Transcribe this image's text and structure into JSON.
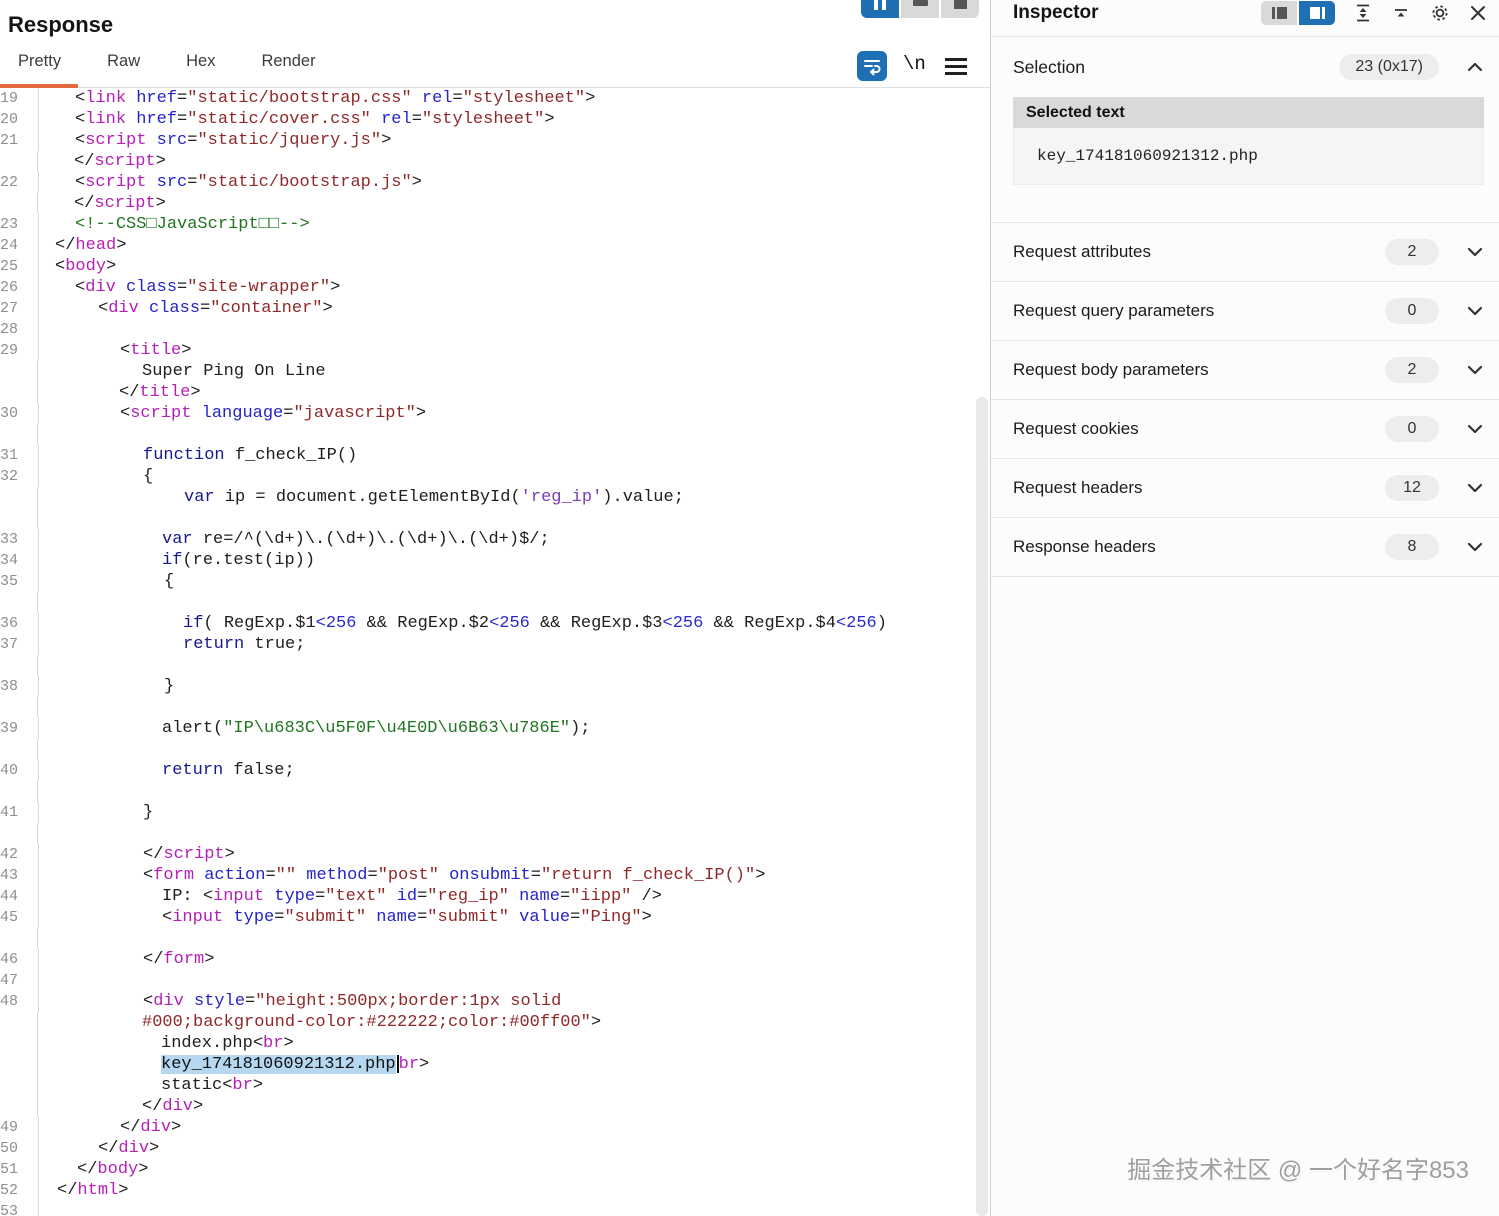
{
  "left_panel": {
    "title": "Response",
    "tabs": [
      {
        "label": "Pretty",
        "active": true
      },
      {
        "label": "Raw",
        "active": false
      },
      {
        "label": "Hex",
        "active": false
      },
      {
        "label": "Render",
        "active": false
      }
    ],
    "toolbar": {
      "newline_label": "\\n"
    },
    "code": {
      "lines": [
        {
          "n": "19",
          "i": 20,
          "s": [
            [
              "p",
              "<"
            ],
            [
              "t",
              "link"
            ],
            [
              "p",
              " "
            ],
            [
              "a",
              "href"
            ],
            [
              "p",
              "="
            ],
            [
              "s",
              "\"static/bootstrap.css\""
            ],
            [
              "p",
              " "
            ],
            [
              "a",
              "rel"
            ],
            [
              "p",
              "="
            ],
            [
              "s",
              "\"stylesheet\""
            ],
            [
              "p",
              ">"
            ]
          ]
        },
        {
          "n": "20",
          "i": 20,
          "s": [
            [
              "p",
              "<"
            ],
            [
              "t",
              "link"
            ],
            [
              "p",
              " "
            ],
            [
              "a",
              "href"
            ],
            [
              "p",
              "="
            ],
            [
              "s",
              "\"static/cover.css\""
            ],
            [
              "p",
              " "
            ],
            [
              "a",
              "rel"
            ],
            [
              "p",
              "="
            ],
            [
              "s",
              "\"stylesheet\""
            ],
            [
              "p",
              ">"
            ]
          ]
        },
        {
          "n": "21",
          "i": 20,
          "s": [
            [
              "p",
              "<"
            ],
            [
              "t",
              "script"
            ],
            [
              "p",
              " "
            ],
            [
              "a",
              "src"
            ],
            [
              "p",
              "="
            ],
            [
              "s",
              "\"static/jquery.js\""
            ],
            [
              "p",
              ">"
            ]
          ]
        },
        {
          "n": "",
          "i": 20,
          "s": [
            [
              "p",
              "</"
            ],
            [
              "t",
              "script"
            ],
            [
              "p",
              ">"
            ]
          ]
        },
        {
          "n": "22",
          "i": 20,
          "s": [
            [
              "p",
              "<"
            ],
            [
              "t",
              "script"
            ],
            [
              "p",
              " "
            ],
            [
              "a",
              "src"
            ],
            [
              "p",
              "="
            ],
            [
              "s",
              "\"static/bootstrap.js\""
            ],
            [
              "p",
              ">"
            ]
          ]
        },
        {
          "n": "",
          "i": 20,
          "s": [
            [
              "p",
              "</"
            ],
            [
              "t",
              "script"
            ],
            [
              "p",
              ">"
            ]
          ]
        },
        {
          "n": "23",
          "i": 20,
          "s": [
            [
              "g",
              "<!--CSS□JavaScript□□-->"
            ]
          ]
        },
        {
          "n": "24",
          "i": 0,
          "s": [
            [
              "p",
              "</"
            ],
            [
              "t",
              "head"
            ],
            [
              "p",
              ">"
            ]
          ]
        },
        {
          "n": "25",
          "i": 0,
          "s": [
            [
              "p",
              "<"
            ],
            [
              "t",
              "body"
            ],
            [
              "p",
              ">"
            ]
          ]
        },
        {
          "n": "26",
          "i": 20,
          "s": [
            [
              "p",
              "<"
            ],
            [
              "t",
              "div"
            ],
            [
              "p",
              " "
            ],
            [
              "a",
              "class"
            ],
            [
              "p",
              "="
            ],
            [
              "s",
              "\"site-wrapper\""
            ],
            [
              "p",
              ">"
            ]
          ]
        },
        {
          "n": "27",
          "i": 43,
          "s": [
            [
              "p",
              "<"
            ],
            [
              "t",
              "div"
            ],
            [
              "p",
              " "
            ],
            [
              "a",
              "class"
            ],
            [
              "p",
              "="
            ],
            [
              "s",
              "\"container\""
            ],
            [
              "p",
              ">"
            ]
          ]
        },
        {
          "n": "28",
          "i": 0,
          "s": []
        },
        {
          "n": "29",
          "i": 65,
          "s": [
            [
              "p",
              "<"
            ],
            [
              "t",
              "title"
            ],
            [
              "p",
              ">"
            ]
          ]
        },
        {
          "n": "",
          "i": 88,
          "s": [
            [
              "p",
              "Super Ping On Line"
            ]
          ]
        },
        {
          "n": "",
          "i": 65,
          "s": [
            [
              "p",
              "</"
            ],
            [
              "t",
              "title"
            ],
            [
              "p",
              ">"
            ]
          ]
        },
        {
          "n": "30",
          "i": 65,
          "s": [
            [
              "p",
              "<"
            ],
            [
              "t",
              "script"
            ],
            [
              "p",
              " "
            ],
            [
              "a",
              "language"
            ],
            [
              "p",
              "="
            ],
            [
              "s",
              "\"javascript\""
            ],
            [
              "p",
              ">"
            ]
          ]
        },
        {
          "n": "",
          "i": 0,
          "s": []
        },
        {
          "n": "31",
          "i": 88,
          "s": [
            [
              "k",
              "function"
            ],
            [
              "p",
              " f_check_IP()"
            ]
          ]
        },
        {
          "n": "32",
          "i": 88,
          "s": [
            [
              "p",
              "{"
            ]
          ]
        },
        {
          "n": "",
          "i": 130,
          "s": [
            [
              "k",
              "var"
            ],
            [
              "p",
              " ip = document.getElementById("
            ],
            [
              "q",
              "'reg_ip'"
            ],
            [
              "p",
              ").value;"
            ]
          ]
        },
        {
          "n": "",
          "i": 0,
          "s": []
        },
        {
          "n": "33",
          "i": 107,
          "s": [
            [
              "k",
              "var"
            ],
            [
              "p",
              " re=/^(\\d+)\\.(\\d+)\\.(\\d+)\\.(\\d+)$/;"
            ]
          ]
        },
        {
          "n": "34",
          "i": 107,
          "s": [
            [
              "k",
              "if"
            ],
            [
              "p",
              "(re.test(ip))"
            ]
          ]
        },
        {
          "n": "35",
          "i": 109,
          "s": [
            [
              "p",
              "{"
            ]
          ]
        },
        {
          "n": "",
          "i": 0,
          "s": []
        },
        {
          "n": "36",
          "i": 128,
          "s": [
            [
              "k",
              "if"
            ],
            [
              "p",
              "( RegExp.$1"
            ],
            [
              "num",
              "<256"
            ],
            [
              "p",
              " && RegExp.$2"
            ],
            [
              "num",
              "<256"
            ],
            [
              "p",
              " && RegExp.$3"
            ],
            [
              "num",
              "<256"
            ],
            [
              "p",
              " && RegExp.$4"
            ],
            [
              "num",
              "<256"
            ],
            [
              "p",
              ")"
            ]
          ]
        },
        {
          "n": "37",
          "i": 128,
          "s": [
            [
              "k",
              "return"
            ],
            [
              "p",
              " true;"
            ]
          ]
        },
        {
          "n": "",
          "i": 0,
          "s": []
        },
        {
          "n": "38",
          "i": 109,
          "s": [
            [
              "p",
              "}"
            ]
          ]
        },
        {
          "n": "",
          "i": 0,
          "s": []
        },
        {
          "n": "39",
          "i": 107,
          "s": [
            [
              "p",
              "alert("
            ],
            [
              "g",
              "\"IP\\u683C\\u5F0F\\u4E0D\\u6B63\\u786E\""
            ],
            [
              "p",
              ");"
            ]
          ]
        },
        {
          "n": "",
          "i": 0,
          "s": []
        },
        {
          "n": "40",
          "i": 107,
          "s": [
            [
              "k",
              "return"
            ],
            [
              "p",
              " false;"
            ]
          ]
        },
        {
          "n": "",
          "i": 0,
          "s": []
        },
        {
          "n": "41",
          "i": 88,
          "s": [
            [
              "p",
              "}"
            ]
          ]
        },
        {
          "n": "",
          "i": 0,
          "s": []
        },
        {
          "n": "42",
          "i": 88,
          "s": [
            [
              "p",
              "</"
            ],
            [
              "t",
              "script"
            ],
            [
              "p",
              ">"
            ]
          ]
        },
        {
          "n": "43",
          "i": 88,
          "s": [
            [
              "p",
              "<"
            ],
            [
              "t",
              "form"
            ],
            [
              "p",
              " "
            ],
            [
              "a",
              "action"
            ],
            [
              "p",
              "="
            ],
            [
              "s",
              "\"\""
            ],
            [
              "p",
              " "
            ],
            [
              "a",
              "method"
            ],
            [
              "p",
              "="
            ],
            [
              "s",
              "\"post\""
            ],
            [
              "p",
              " "
            ],
            [
              "a",
              "onsubmit"
            ],
            [
              "p",
              "="
            ],
            [
              "s",
              "\"return f_check_IP()\""
            ],
            [
              "p",
              ">"
            ]
          ]
        },
        {
          "n": "44",
          "i": 107,
          "s": [
            [
              "p",
              "IP: <"
            ],
            [
              "t",
              "input"
            ],
            [
              "p",
              " "
            ],
            [
              "a",
              "type"
            ],
            [
              "p",
              "="
            ],
            [
              "s",
              "\"text\""
            ],
            [
              "p",
              " "
            ],
            [
              "a",
              "id"
            ],
            [
              "p",
              "="
            ],
            [
              "s",
              "\"reg_ip\""
            ],
            [
              "p",
              " "
            ],
            [
              "a",
              "name"
            ],
            [
              "p",
              "="
            ],
            [
              "s",
              "\"iipp\""
            ],
            [
              "p",
              " />"
            ]
          ]
        },
        {
          "n": "45",
          "i": 107,
          "s": [
            [
              "p",
              "<"
            ],
            [
              "t",
              "input"
            ],
            [
              "p",
              " "
            ],
            [
              "a",
              "type"
            ],
            [
              "p",
              "="
            ],
            [
              "s",
              "\"submit\""
            ],
            [
              "p",
              " "
            ],
            [
              "a",
              "name"
            ],
            [
              "p",
              "="
            ],
            [
              "s",
              "\"submit\""
            ],
            [
              "p",
              " "
            ],
            [
              "a",
              "value"
            ],
            [
              "p",
              "="
            ],
            [
              "s",
              "\"Ping\""
            ],
            [
              "p",
              ">"
            ]
          ]
        },
        {
          "n": "",
          "i": 0,
          "s": []
        },
        {
          "n": "46",
          "i": 88,
          "s": [
            [
              "p",
              "</"
            ],
            [
              "t",
              "form"
            ],
            [
              "p",
              ">"
            ]
          ]
        },
        {
          "n": "47",
          "i": 0,
          "s": []
        },
        {
          "n": "48",
          "i": 88,
          "s": [
            [
              "p",
              "<"
            ],
            [
              "t",
              "div"
            ],
            [
              "p",
              " "
            ],
            [
              "a",
              "style"
            ],
            [
              "p",
              "="
            ],
            [
              "s",
              "\"height:500px;border:1px solid"
            ]
          ]
        },
        {
          "n": "",
          "i": 88,
          "s": [
            [
              "s",
              "#000;background-color:#222222;color:#00ff00\""
            ],
            [
              "p",
              ">"
            ]
          ]
        },
        {
          "n": "",
          "i": 107,
          "s": [
            [
              "p",
              "index.php<"
            ],
            [
              "t",
              "br"
            ],
            [
              "p",
              ">"
            ]
          ]
        },
        {
          "n": "",
          "i": 107,
          "s": [
            [
              "sel",
              "key_174181060921312.php"
            ],
            [
              "cur",
              ""
            ],
            [
              "t",
              "br"
            ],
            [
              "p",
              ">"
            ]
          ]
        },
        {
          "n": "",
          "i": 107,
          "s": [
            [
              "p",
              "static<"
            ],
            [
              "t",
              "br"
            ],
            [
              "p",
              ">"
            ]
          ]
        },
        {
          "n": "",
          "i": 88,
          "s": [
            [
              "p",
              "</"
            ],
            [
              "t",
              "div"
            ],
            [
              "p",
              ">"
            ]
          ]
        },
        {
          "n": "49",
          "i": 65,
          "s": [
            [
              "p",
              "</"
            ],
            [
              "t",
              "div"
            ],
            [
              "p",
              ">"
            ]
          ]
        },
        {
          "n": "50",
          "i": 43,
          "s": [
            [
              "p",
              "</"
            ],
            [
              "t",
              "div"
            ],
            [
              "p",
              ">"
            ]
          ]
        },
        {
          "n": "51",
          "i": 22,
          "s": [
            [
              "p",
              "</"
            ],
            [
              "t",
              "body"
            ],
            [
              "p",
              ">"
            ]
          ]
        },
        {
          "n": "52",
          "i": 2,
          "s": [
            [
              "p",
              "</"
            ],
            [
              "t",
              "html"
            ],
            [
              "p",
              ">"
            ]
          ]
        },
        {
          "n": "53",
          "i": 0,
          "s": []
        }
      ]
    }
  },
  "inspector": {
    "title": "Inspector",
    "selection": {
      "label": "Selection",
      "badge": "23 (0x17)"
    },
    "selected_text": {
      "header": "Selected text",
      "value": "key_174181060921312.php"
    },
    "sections": [
      {
        "label": "Request attributes",
        "count": "2"
      },
      {
        "label": "Request query parameters",
        "count": "0"
      },
      {
        "label": "Request body parameters",
        "count": "2"
      },
      {
        "label": "Request cookies",
        "count": "0"
      },
      {
        "label": "Request headers",
        "count": "12"
      },
      {
        "label": "Response headers",
        "count": "8"
      }
    ]
  },
  "watermark": {
    "text": "掘金技术社区 @ 一个好名字853"
  },
  "colors": {
    "accent_orange": "#e5693e",
    "accent_blue": "#1e6fb4",
    "syntax_tag": "#b520b5",
    "syntax_attr": "#2424c9",
    "syntax_string": "#8f2929",
    "syntax_keyword": "#17178f",
    "syntax_number": "#2a2ad2",
    "syntax_green": "#207520",
    "syntax_purple_string": "#7d3cb5",
    "selection_highlight": "#b5d8f0"
  }
}
